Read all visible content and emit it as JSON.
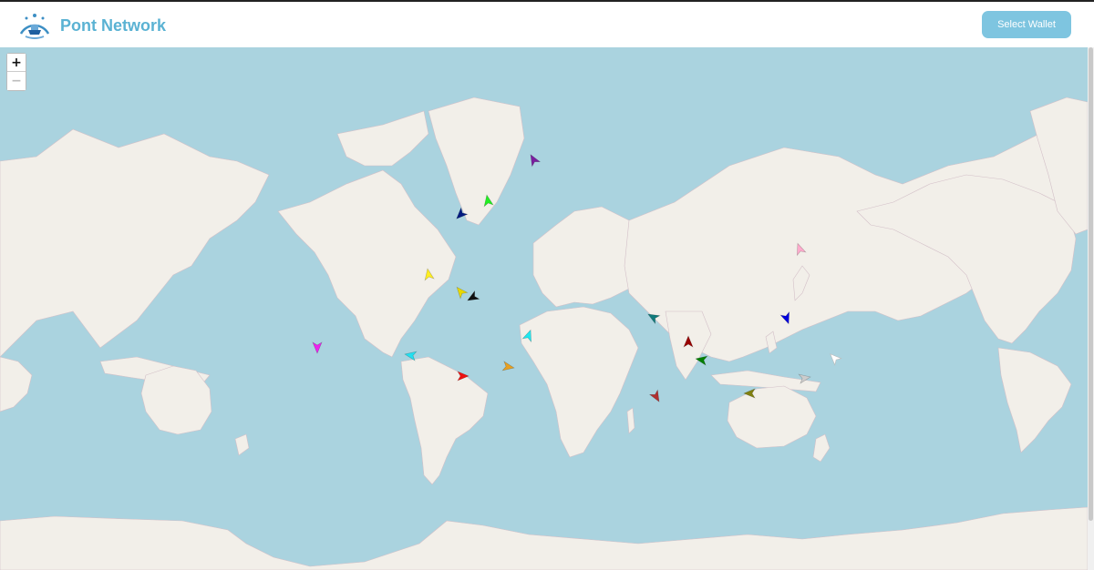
{
  "app": {
    "brand_name": "Pont Network"
  },
  "header": {
    "wallet_button_label": "Select Wallet"
  },
  "map": {
    "zoom_in_label": "+",
    "zoom_out_label": "−",
    "colors": {
      "water": "#aad3df",
      "land": "#f2efe9",
      "border": "#d3c0c8"
    },
    "vessels": [
      {
        "color": "#7a1ea0"
      },
      {
        "color": "#22ee22"
      },
      {
        "color": "#001a80"
      },
      {
        "color": "#ffee22"
      },
      {
        "color": "#e8d800"
      },
      {
        "color": "#111111"
      },
      {
        "color": "#22e6ee"
      },
      {
        "color": "#ee22ee"
      },
      {
        "color": "#22e0f0"
      },
      {
        "color": "#ee1111"
      },
      {
        "color": "#e8a020"
      },
      {
        "color": "#ffaacc"
      },
      {
        "color": "#107a7a"
      },
      {
        "color": "#0000dd"
      },
      {
        "color": "#990000"
      },
      {
        "color": "#008000"
      },
      {
        "color": "#ffffff"
      },
      {
        "color": "#cccccc"
      },
      {
        "color": "#808010"
      },
      {
        "color": "#b03030"
      }
    ]
  }
}
